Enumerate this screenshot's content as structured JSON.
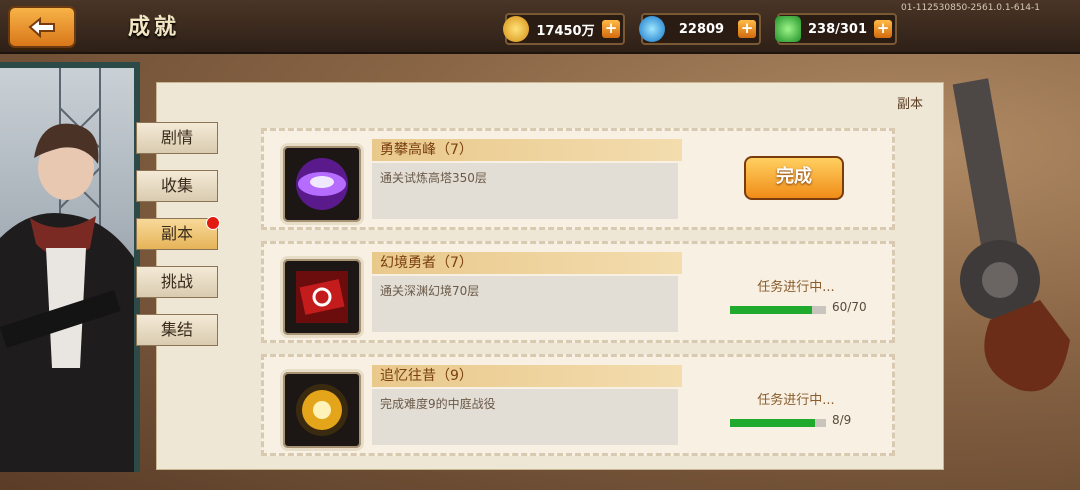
{
  "header": {
    "title": "成就",
    "version_text": "01-112530850-2561.0.1-614-1",
    "resources": [
      {
        "icon": "gold-coin-icon",
        "value": "17450万",
        "color": "#f2b421"
      },
      {
        "icon": "blue-gem-icon",
        "value": "22809",
        "color": "#2a9be0"
      },
      {
        "icon": "green-stamina-icon",
        "value": "238/301",
        "color": "#36b742"
      }
    ],
    "plus_label": "+"
  },
  "sidebar": {
    "tabs": [
      {
        "label": "剧情"
      },
      {
        "label": "收集"
      },
      {
        "label": "副本",
        "active": true
      },
      {
        "label": "挑战"
      },
      {
        "label": "集结"
      }
    ]
  },
  "panel": {
    "category_label": "副本",
    "achievements": [
      {
        "icon": "purple-orb-icon",
        "name": "勇攀高峰（7）",
        "description": "通关试炼高塔350层",
        "state": "complete",
        "button_label": "完成"
      },
      {
        "icon": "red-ticket-icon",
        "name": "幻境勇者（7）",
        "description": "通关深渊幻境70层",
        "state": "in_progress",
        "status_text": "任务进行中...",
        "progress_text": "60/70",
        "progress": 0.857
      },
      {
        "icon": "gold-compass-icon",
        "name": "追忆往昔（9）",
        "description": "完成难度9的中庭战役",
        "state": "in_progress",
        "status_text": "任务进行中...",
        "progress_text": "8/9",
        "progress": 0.889
      }
    ]
  }
}
